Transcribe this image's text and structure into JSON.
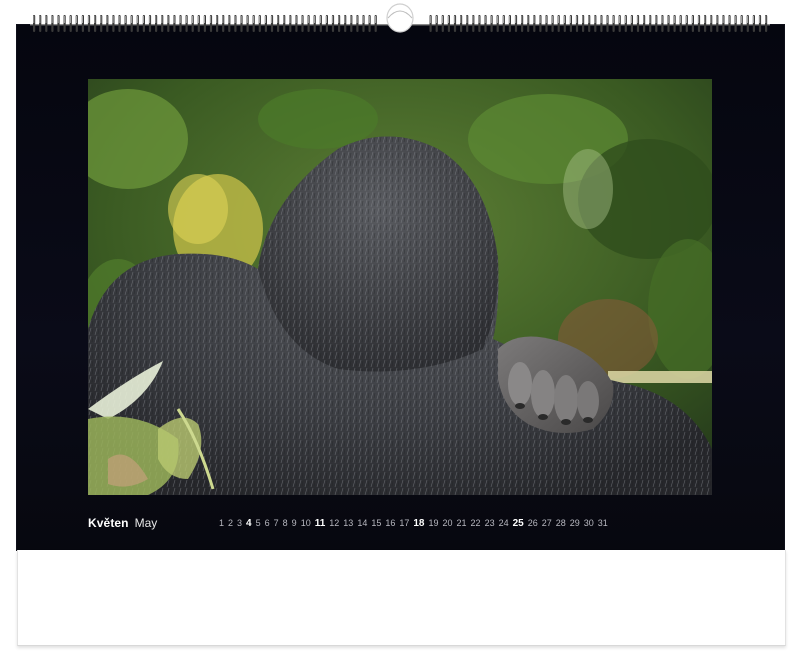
{
  "calendar": {
    "month_cz": "Květen",
    "month_en": "May",
    "days": [
      {
        "n": "1",
        "sunday": false
      },
      {
        "n": "2",
        "sunday": false
      },
      {
        "n": "3",
        "sunday": false
      },
      {
        "n": "4",
        "sunday": true
      },
      {
        "n": "5",
        "sunday": false
      },
      {
        "n": "6",
        "sunday": false
      },
      {
        "n": "7",
        "sunday": false
      },
      {
        "n": "8",
        "sunday": false
      },
      {
        "n": "9",
        "sunday": false
      },
      {
        "n": "10",
        "sunday": false
      },
      {
        "n": "11",
        "sunday": true
      },
      {
        "n": "12",
        "sunday": false
      },
      {
        "n": "13",
        "sunday": false
      },
      {
        "n": "14",
        "sunday": false
      },
      {
        "n": "15",
        "sunday": false
      },
      {
        "n": "16",
        "sunday": false
      },
      {
        "n": "17",
        "sunday": false
      },
      {
        "n": "18",
        "sunday": true
      },
      {
        "n": "19",
        "sunday": false
      },
      {
        "n": "20",
        "sunday": false
      },
      {
        "n": "21",
        "sunday": false
      },
      {
        "n": "22",
        "sunday": false
      },
      {
        "n": "23",
        "sunday": false
      },
      {
        "n": "24",
        "sunday": false
      },
      {
        "n": "25",
        "sunday": true
      },
      {
        "n": "26",
        "sunday": false
      },
      {
        "n": "27",
        "sunday": false
      },
      {
        "n": "28",
        "sunday": false
      },
      {
        "n": "29",
        "sunday": false
      },
      {
        "n": "30",
        "sunday": false
      },
      {
        "n": "31",
        "sunday": false
      }
    ]
  },
  "photo": {
    "subject": "gorilla-back",
    "icon": "gorilla-photo"
  },
  "colors": {
    "sheet_dark": "#06070f",
    "sheet_light": "#ffffff",
    "binding": "#2a2a2a",
    "sunday": "#ffffff",
    "weekday": "#b8b8c0"
  }
}
